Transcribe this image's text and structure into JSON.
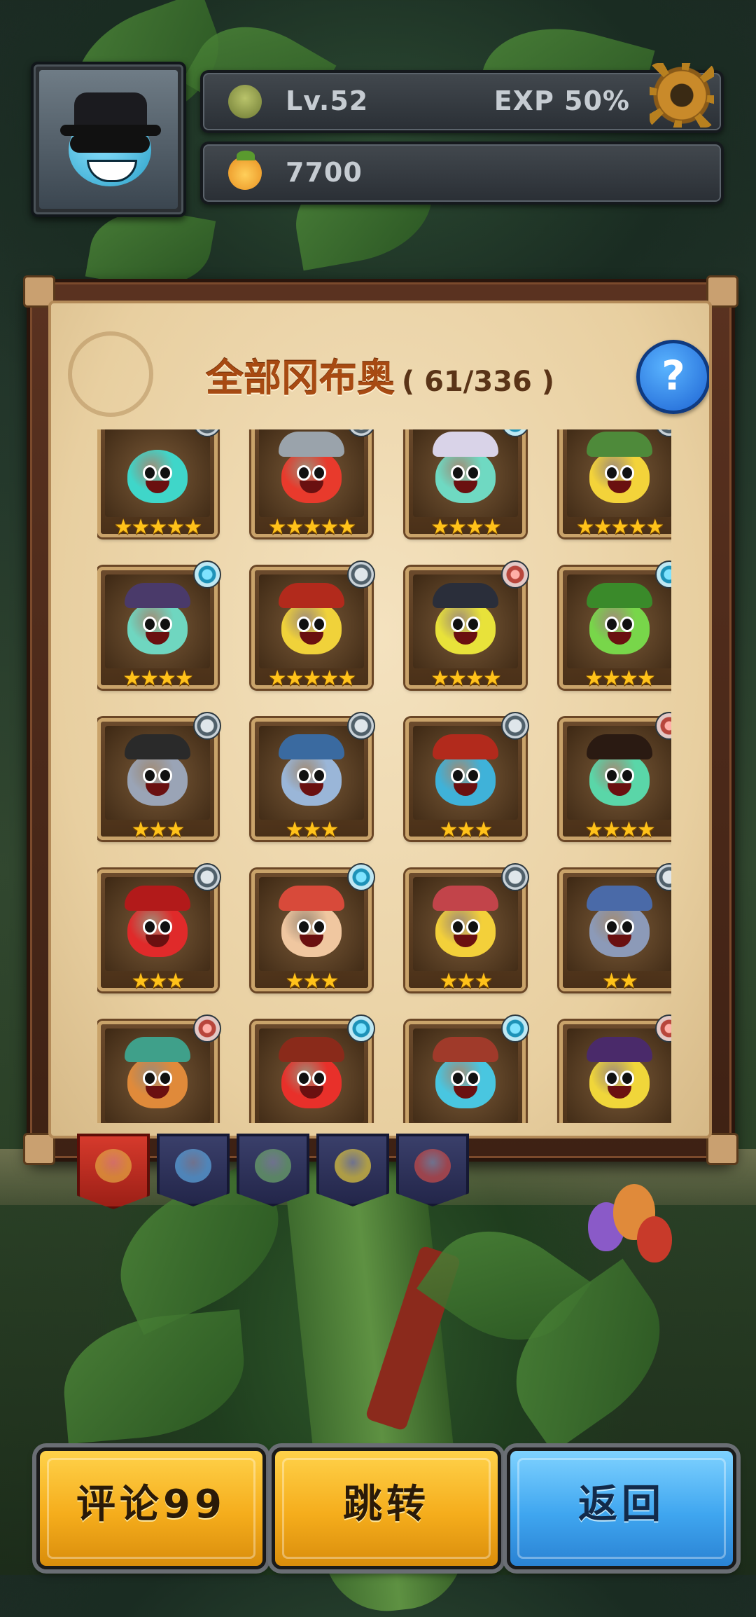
{
  "hud": {
    "level_label": "Lv.52",
    "exp_label": "EXP 50%",
    "exp_progress": 0.5,
    "coin_amount": "7700"
  },
  "panel": {
    "title": "全部冈布奥",
    "count": "( 61/336 )",
    "help_label": "?"
  },
  "cards": [
    {
      "color": "#3fd6c9",
      "badge": "sword",
      "stars": "★★★★★",
      "hat": "none"
    },
    {
      "color": "#e83a2c",
      "badge": "sword",
      "stars": "★★★★★",
      "hat": "#9aa3ab"
    },
    {
      "color": "#6fd9c2",
      "badge": "swirl",
      "stars": "★★★★",
      "hat": "#d9d3e8"
    },
    {
      "color": "#f3d33a",
      "badge": "sword",
      "stars": "★★★★★",
      "hat": "#4e8a3a"
    },
    {
      "color": "#6fd6c0",
      "badge": "swirl",
      "stars": "★★★★",
      "hat": "#4a3a6a"
    },
    {
      "color": "#f0d23a",
      "badge": "sword",
      "stars": "★★★★★",
      "hat": "#b22a1c"
    },
    {
      "color": "#e8e23a",
      "badge": "arrow",
      "stars": "★★★★",
      "hat": "#2a2e3a"
    },
    {
      "color": "#78d64a",
      "badge": "swirl",
      "stars": "★★★★",
      "hat": "#3a8a2a"
    },
    {
      "color": "#9aa4b6",
      "badge": "sword",
      "stars": "★★★",
      "hat": "#2a2a2a"
    },
    {
      "color": "#9ab6d8",
      "badge": "sword",
      "stars": "★★★",
      "hat": "#3a6aa0"
    },
    {
      "color": "#3fb2d9",
      "badge": "sword",
      "stars": "★★★",
      "hat": "#b22a1c"
    },
    {
      "color": "#5ad6a8",
      "badge": "arrow",
      "stars": "★★★★",
      "hat": "#2a1a12"
    },
    {
      "color": "#e02a2a",
      "badge": "sword",
      "stars": "★★★",
      "hat": "#b21a1a"
    },
    {
      "color": "#f0c7a0",
      "badge": "swirl",
      "stars": "★★★",
      "hat": "#d84a3a"
    },
    {
      "color": "#f3d03a",
      "badge": "sword",
      "stars": "★★★",
      "hat": "#c2444a"
    },
    {
      "color": "#8c9ab8",
      "badge": "sword",
      "stars": "★★",
      "hat": "#4a6aa8"
    },
    {
      "color": "#e08a3a",
      "badge": "arrow",
      "stars": "★★",
      "hat": "#3fa08a"
    },
    {
      "color": "#e8302a",
      "badge": "swirl",
      "stars": "★★",
      "hat": "#8a2a1a"
    },
    {
      "color": "#49c6e0",
      "badge": "swirl",
      "stars": "★★",
      "hat": "#a03a2a"
    },
    {
      "color": "#f0d63a",
      "badge": "arrow",
      "stars": "★★",
      "hat": "#4a2a6a"
    }
  ],
  "tabs": [
    {
      "name": "all",
      "active": true,
      "icon_color": "#e0a040"
    },
    {
      "name": "blue",
      "active": false,
      "icon_color": "#5aa0d8"
    },
    {
      "name": "green",
      "active": false,
      "icon_color": "#6aa06a"
    },
    {
      "name": "yellow",
      "active": false,
      "icon_color": "#d8c040"
    },
    {
      "name": "red",
      "active": false,
      "icon_color": "#c04a4a"
    }
  ],
  "buttons": {
    "comment_label": "评论99",
    "jump_label": "跳转",
    "back_label": "返回"
  },
  "colors": {
    "title": "#a74a12",
    "gold_button": "#f5ad1c",
    "blue_button": "#3fa6f0",
    "star": "#ffc21a"
  }
}
